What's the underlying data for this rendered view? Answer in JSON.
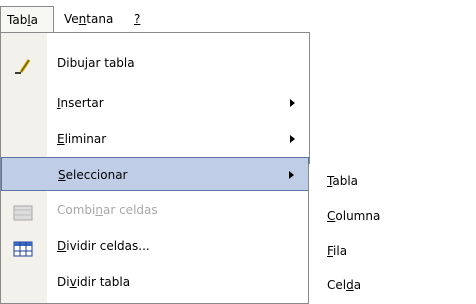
{
  "menubar": {
    "items": [
      {
        "pre": "Tab",
        "ul": "l",
        "post": "a"
      },
      {
        "pre": "Ve",
        "ul": "n",
        "post": "tana"
      },
      {
        "pre": "",
        "ul": "?",
        "post": ""
      }
    ]
  },
  "menu": {
    "items": [
      {
        "pre": "Dibu",
        "ul": "j",
        "post": "ar tabla",
        "icon": "pencil-icon"
      },
      {
        "pre": "",
        "ul": "I",
        "post": "nsertar"
      },
      {
        "pre": "",
        "ul": "E",
        "post": "liminar"
      },
      {
        "pre": "",
        "ul": "S",
        "post": "eleccionar"
      },
      {
        "pre": "Combi",
        "ul": "n",
        "post": "ar celdas",
        "icon": "merge-cells-icon"
      },
      {
        "pre": "",
        "ul": "D",
        "post": "ividir celdas...",
        "icon": "split-cells-icon"
      },
      {
        "pre": "Di",
        "ul": "v",
        "post": "idir tabla"
      }
    ]
  },
  "submenu": {
    "items": [
      {
        "pre": "",
        "ul": "T",
        "post": "abla"
      },
      {
        "pre": "",
        "ul": "C",
        "post": "olumna"
      },
      {
        "pre": "",
        "ul": "F",
        "post": "ila"
      },
      {
        "pre": "Cel",
        "ul": "d",
        "post": "a"
      }
    ]
  },
  "colors": {
    "highlight": "#bfcde6",
    "highlight_border": "#5a75a8",
    "disabled_text": "#a8a8a8"
  }
}
